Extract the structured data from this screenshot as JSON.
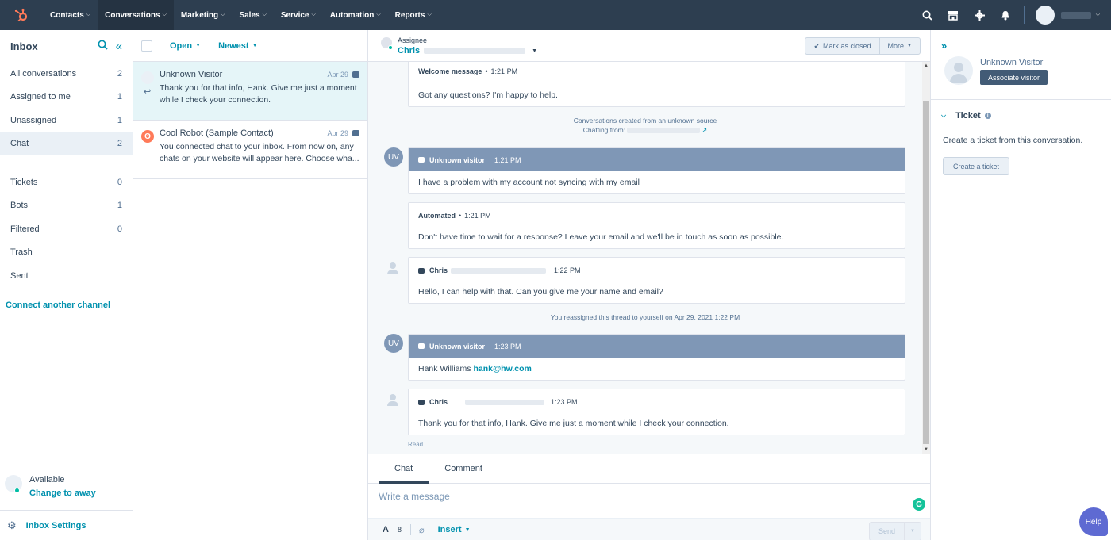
{
  "nav": {
    "items": [
      {
        "label": "Contacts",
        "active": false
      },
      {
        "label": "Conversations",
        "active": true
      },
      {
        "label": "Marketing",
        "active": false
      },
      {
        "label": "Sales",
        "active": false
      },
      {
        "label": "Service",
        "active": false
      },
      {
        "label": "Automation",
        "active": false
      },
      {
        "label": "Reports",
        "active": false
      }
    ],
    "icons": [
      "search-icon",
      "marketplace-icon",
      "settings-icon",
      "notifications-icon"
    ]
  },
  "sidebar": {
    "title": "Inbox",
    "items": [
      {
        "label": "All conversations",
        "count": "2"
      },
      {
        "label": "Assigned to me",
        "count": "1"
      },
      {
        "label": "Unassigned",
        "count": "1"
      },
      {
        "label": "Chat",
        "count": "2"
      }
    ],
    "items2": [
      {
        "label": "Tickets",
        "count": "0"
      },
      {
        "label": "Bots",
        "count": "1"
      },
      {
        "label": "Filtered",
        "count": "0"
      },
      {
        "label": "Trash",
        "count": ""
      },
      {
        "label": "Sent",
        "count": ""
      }
    ],
    "connect_link": "Connect another channel",
    "status": "Available",
    "status_link": "Change to away",
    "settings": "Inbox Settings"
  },
  "list": {
    "filter": "Open",
    "sort": "Newest",
    "conversations": [
      {
        "name": "Unknown Visitor",
        "date": "Apr 29",
        "preview": "Thank you for that info, Hank. Give me just a moment while I check your connection."
      },
      {
        "name": "Cool Robot (Sample Contact)",
        "date": "Apr 29",
        "preview": "You connected chat to your inbox. From now on, any chats on your website will appear here. Choose wha..."
      }
    ]
  },
  "header": {
    "assignee_label": "Assignee",
    "assignee_name": "Chris",
    "mark_closed": "Mark as closed",
    "more": "More"
  },
  "thread": {
    "welcome_label": "Welcome message",
    "welcome_time": "1:21 PM",
    "welcome_text": "Got any questions? I'm happy to help.",
    "source_line": "Conversations created from an unknown source",
    "chatting_from": "Chatting from:",
    "uv_initials": "UV",
    "visitor_label": "Unknown visitor",
    "msg1_time": "1:21 PM",
    "msg1_text": "I have a problem with my account not syncing with my email",
    "auto_label": "Automated",
    "auto_time": "1:21 PM",
    "auto_text": "Don't have time to wait for a response? Leave your email and we'll be in touch as soon as possible.",
    "agent_name": "Chris",
    "agent_msg1_time": "1:22 PM",
    "agent_msg1_text": "Hello, I can help with that. Can you give me your name and email?",
    "reassign_note": "You reassigned this thread to yourself on Apr 29, 2021 1:22 PM",
    "msg2_time": "1:23 PM",
    "msg2_name": "Hank Williams",
    "msg2_email": "hank@hw.com",
    "agent_msg2_time": "1:23 PM",
    "agent_msg2_text": "Thank you for that info, Hank. Give me just a moment while I check your connection.",
    "read": "Read"
  },
  "composer": {
    "tab_chat": "Chat",
    "tab_comment": "Comment",
    "placeholder": "Write a message",
    "insert": "Insert",
    "send": "Send"
  },
  "right": {
    "visitor_name": "Unknown Visitor",
    "associate": "Associate visitor",
    "ticket_title": "Ticket",
    "ticket_text": "Create a ticket from this conversation.",
    "ticket_button": "Create a ticket"
  },
  "help": "Help",
  "colors": {
    "nav_bg": "#2d3e50",
    "accent": "#0091ae",
    "visitor_header": "#7f97b6",
    "brand_orange": "#ff7a59"
  }
}
